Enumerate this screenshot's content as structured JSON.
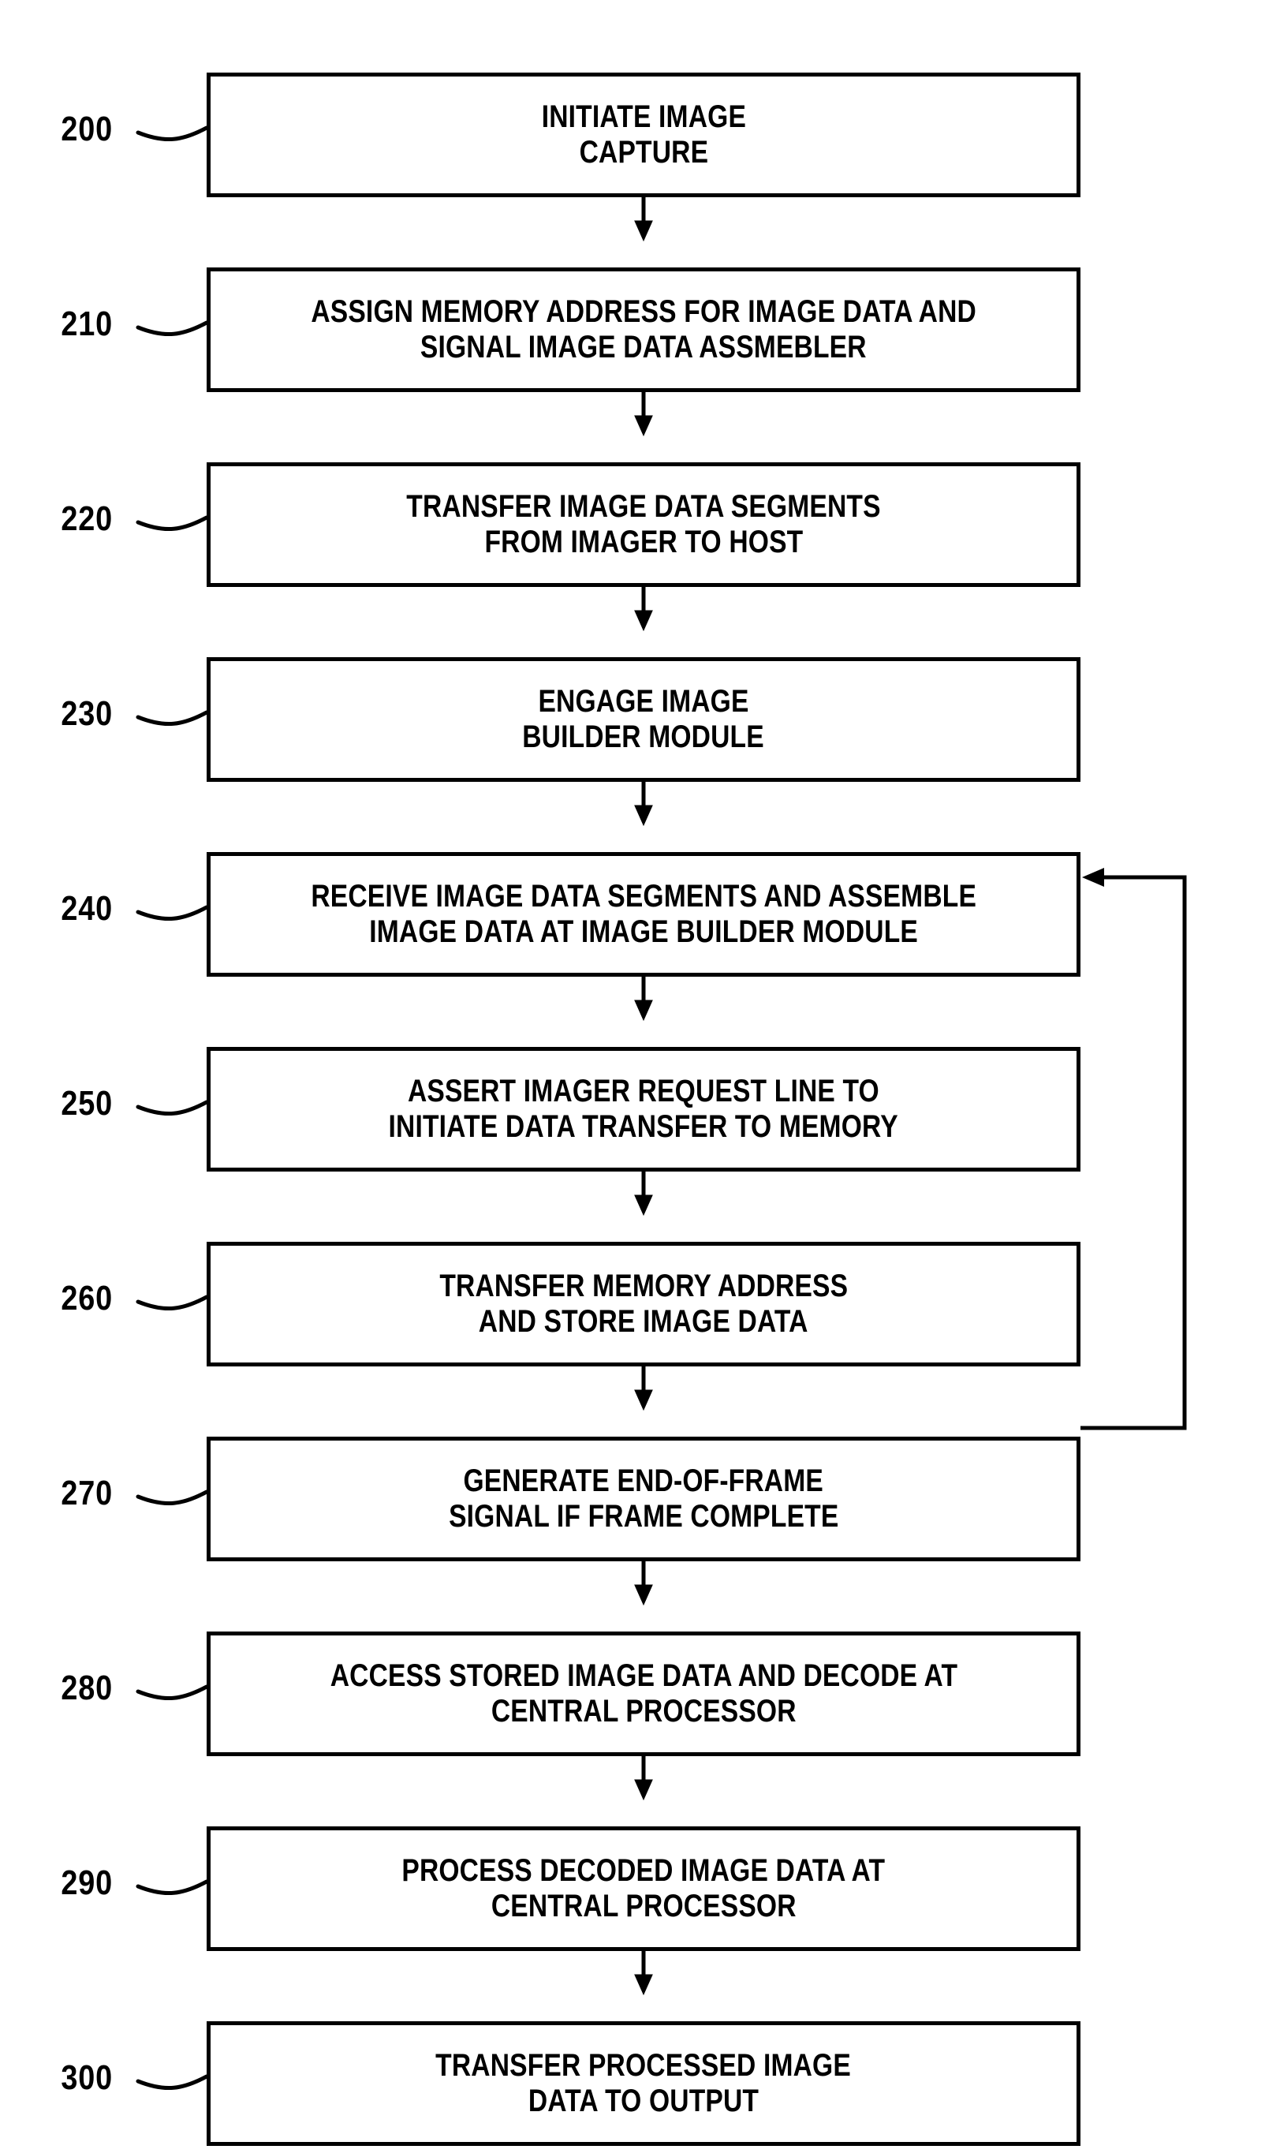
{
  "figure": {
    "type": "patent-flowchart",
    "orientation": "vertical",
    "background_color": "#ffffff",
    "line_color": "#000000"
  },
  "steps": [
    {
      "ref": "200",
      "name": "initiate-image-capture",
      "lines": [
        "INITIATE IMAGE",
        "CAPTURE"
      ]
    },
    {
      "ref": "210",
      "name": "assign-memory-address",
      "lines": [
        "ASSIGN MEMORY ADDRESS FOR IMAGE DATA AND",
        "SIGNAL IMAGE DATA ASSMEBLER"
      ]
    },
    {
      "ref": "220",
      "name": "transfer-image-data-segments",
      "lines": [
        "TRANSFER IMAGE DATA SEGMENTS",
        "FROM IMAGER TO HOST"
      ]
    },
    {
      "ref": "230",
      "name": "engage-image-builder-module",
      "lines": [
        "ENGAGE IMAGE",
        "BUILDER MODULE"
      ]
    },
    {
      "ref": "240",
      "name": "receive-and-assemble-image-data",
      "lines": [
        "RECEIVE IMAGE DATA SEGMENTS AND ASSEMBLE",
        "IMAGE DATA AT IMAGE BUILDER MODULE"
      ]
    },
    {
      "ref": "250",
      "name": "assert-imager-request-line",
      "lines": [
        "ASSERT IMAGER REQUEST LINE TO",
        "INITIATE DATA TRANSFER TO MEMORY"
      ]
    },
    {
      "ref": "260",
      "name": "transfer-memory-address-and-store",
      "lines": [
        "TRANSFER MEMORY ADDRESS",
        "AND STORE IMAGE DATA"
      ]
    },
    {
      "ref": "270",
      "name": "generate-end-of-frame-signal",
      "lines": [
        "GENERATE END-OF-FRAME",
        "SIGNAL IF FRAME COMPLETE"
      ]
    },
    {
      "ref": "280",
      "name": "access-stored-image-data-and-decode",
      "lines": [
        "ACCESS STORED IMAGE DATA AND DECODE AT",
        "CENTRAL PROCESSOR"
      ]
    },
    {
      "ref": "290",
      "name": "process-decoded-image-data",
      "lines": [
        "PROCESS DECODED IMAGE DATA AT",
        "CENTRAL PROCESSOR"
      ]
    },
    {
      "ref": "300",
      "name": "transfer-processed-image-data-to-output",
      "lines": [
        "TRANSFER PROCESSED IMAGE",
        "DATA TO OUTPUT"
      ]
    }
  ],
  "feedback_loop": {
    "from_ref": "270",
    "to_ref": "240",
    "direction": "upward-right-return"
  }
}
